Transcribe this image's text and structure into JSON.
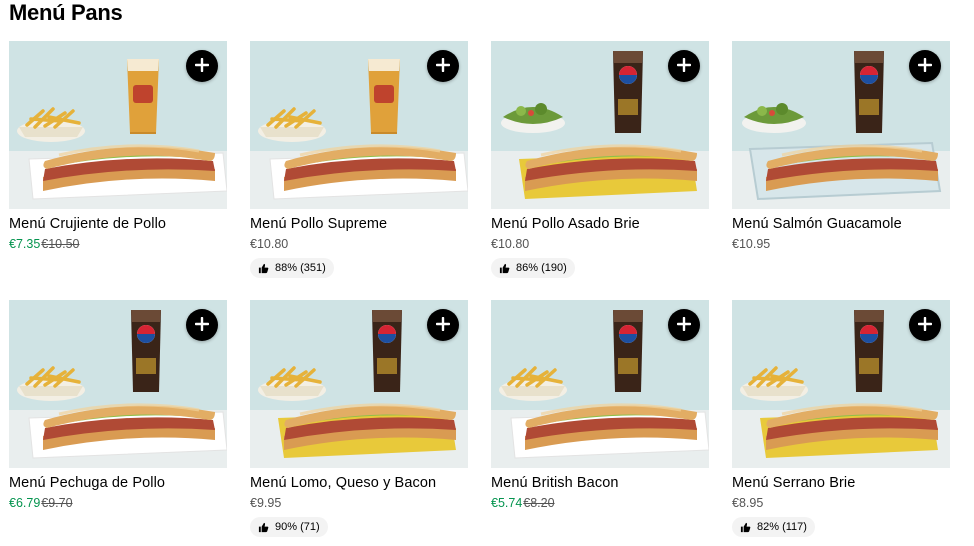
{
  "section": {
    "title": "Menú Pans"
  },
  "colors": {
    "accent_sale": "#05944f",
    "button": "#000000",
    "background": "#ffffff"
  },
  "items": [
    {
      "name": "Menú Crujiente de Pollo",
      "price": "€7.35",
      "old_price": "€10.50",
      "rating": "",
      "drink": "beer",
      "tray": "white",
      "side": "fries"
    },
    {
      "name": "Menú Pollo Supreme",
      "price": "€10.80",
      "old_price": "",
      "rating": "88% (351)",
      "drink": "beer",
      "tray": "white",
      "side": "fries"
    },
    {
      "name": "Menú Pollo Asado Brie",
      "price": "€10.80",
      "old_price": "",
      "rating": "86% (190)",
      "drink": "cola",
      "tray": "yellow",
      "side": "salad"
    },
    {
      "name": "Menú Salmón Guacamole",
      "price": "€10.95",
      "old_price": "",
      "rating": "",
      "drink": "cola",
      "tray": "glass",
      "side": "salad"
    },
    {
      "name": "Menú Pechuga de Pollo",
      "price": "€6.79",
      "old_price": "€9.70",
      "rating": "",
      "drink": "cola",
      "tray": "white",
      "side": "fries"
    },
    {
      "name": "Menú Lomo, Queso y Bacon",
      "price": "€9.95",
      "old_price": "",
      "rating": "90% (71)",
      "drink": "cola",
      "tray": "yellow",
      "side": "fries"
    },
    {
      "name": "Menú British Bacon",
      "price": "€5.74",
      "old_price": "€8.20",
      "rating": "",
      "drink": "cola",
      "tray": "white",
      "side": "fries"
    },
    {
      "name": "Menú Serrano Brie",
      "price": "€8.95",
      "old_price": "",
      "rating": "82% (117)",
      "drink": "cola",
      "tray": "yellow",
      "side": "fries"
    }
  ],
  "icons": {
    "add": "plus-icon",
    "rating": "thumbs-up-icon"
  }
}
